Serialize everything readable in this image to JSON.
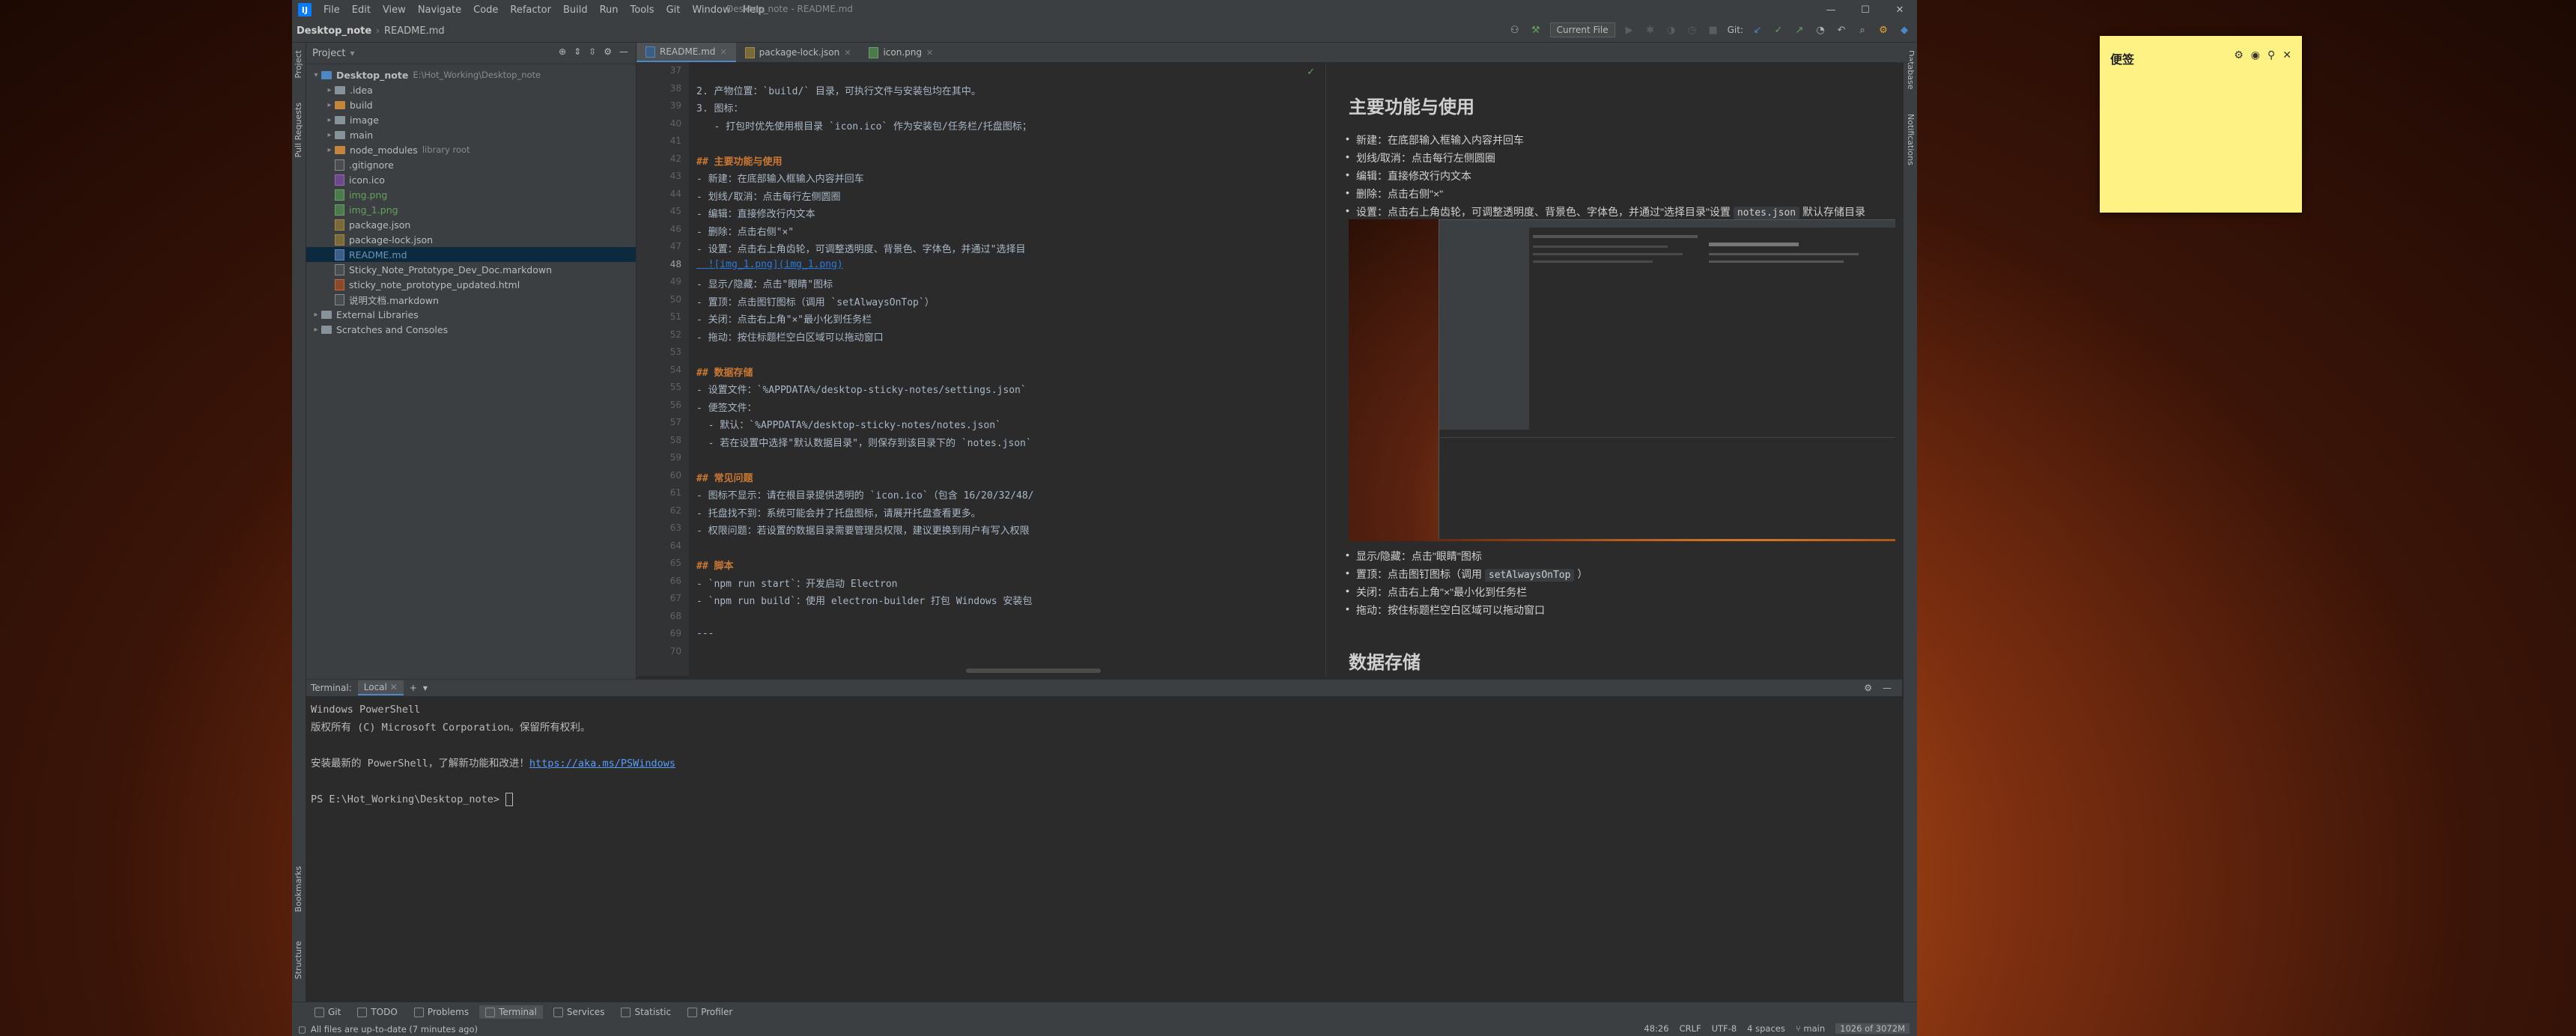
{
  "window": {
    "title": "Desktop_note - README.md"
  },
  "menu": [
    "File",
    "Edit",
    "View",
    "Navigate",
    "Code",
    "Refactor",
    "Build",
    "Run",
    "Tools",
    "Git",
    "Window",
    "Help"
  ],
  "breadcrumb": [
    "Desktop_note",
    "README.md"
  ],
  "toolbar": {
    "run_config": "Current File",
    "git_label": "Git:"
  },
  "project": {
    "header": "Project",
    "tree": [
      {
        "indent": 0,
        "arrow": "▾",
        "type": "folder",
        "label": "Desktop_note",
        "extra": "E:\\Hot_Working\\Desktop_note",
        "bold": true
      },
      {
        "indent": 1,
        "arrow": "▸",
        "type": "folder",
        "label": ".idea"
      },
      {
        "indent": 1,
        "arrow": "▸",
        "type": "folder-orange",
        "label": "build"
      },
      {
        "indent": 1,
        "arrow": "▸",
        "type": "folder",
        "label": "image"
      },
      {
        "indent": 1,
        "arrow": "▸",
        "type": "folder",
        "label": "main"
      },
      {
        "indent": 1,
        "arrow": "▸",
        "type": "folder-orange",
        "label": "node_modules",
        "extra": "library root"
      },
      {
        "indent": 1,
        "arrow": "",
        "type": "file",
        "label": ".gitignore"
      },
      {
        "indent": 1,
        "arrow": "",
        "type": "ico",
        "label": "icon.ico"
      },
      {
        "indent": 1,
        "arrow": "",
        "type": "img",
        "label": "img.png",
        "color": "green"
      },
      {
        "indent": 1,
        "arrow": "",
        "type": "img",
        "label": "img_1.png",
        "color": "green"
      },
      {
        "indent": 1,
        "arrow": "",
        "type": "json",
        "label": "package.json"
      },
      {
        "indent": 1,
        "arrow": "",
        "type": "json",
        "label": "package-lock.json"
      },
      {
        "indent": 1,
        "arrow": "",
        "type": "md",
        "label": "README.md",
        "color": "blue"
      },
      {
        "indent": 1,
        "arrow": "",
        "type": "file",
        "label": "Sticky_Note_Prototype_Dev_Doc.markdown"
      },
      {
        "indent": 1,
        "arrow": "",
        "type": "html",
        "label": "sticky_note_prototype_updated.html"
      },
      {
        "indent": 1,
        "arrow": "",
        "type": "file",
        "label": "说明文档.markdown"
      },
      {
        "indent": 0,
        "arrow": "▸",
        "type": "folder",
        "label": "External Libraries"
      },
      {
        "indent": 0,
        "arrow": "▸",
        "type": "folder",
        "label": "Scratches and Consoles"
      }
    ]
  },
  "editor_tabs": [
    {
      "label": "README.md",
      "active": true
    },
    {
      "label": "package-lock.json",
      "active": false
    },
    {
      "label": "icon.png",
      "active": false
    }
  ],
  "source": {
    "lines": [
      {
        "n": "37",
        "text": ""
      },
      {
        "n": "38",
        "text": "2. 产物位置：`build/` 目录，可执行文件与安装包均在其中。"
      },
      {
        "n": "39",
        "text": "3. 图标："
      },
      {
        "n": "40",
        "text": "   - 打包时优先使用根目录 `icon.ico` 作为安装包/任务栏/托盘图标；"
      },
      {
        "n": "41",
        "text": ""
      },
      {
        "n": "42",
        "text": "## 主要功能与使用"
      },
      {
        "n": "43",
        "text": "- 新建：在底部输入框输入内容并回车"
      },
      {
        "n": "44",
        "text": "- 划线/取消：点击每行左侧圆圈"
      },
      {
        "n": "45",
        "text": "- 编辑：直接修改行内文本"
      },
      {
        "n": "46",
        "text": "- 删除：点击右侧\"×\""
      },
      {
        "n": "47",
        "text": "- 设置：点击右上角齿轮，可调整透明度、背景色、字体色，并通过\"选择目"
      },
      {
        "n": "48",
        "text": "  ![img_1.png](img_1.png)"
      },
      {
        "n": "49",
        "text": "- 显示/隐藏：点击\"眼睛\"图标"
      },
      {
        "n": "50",
        "text": "- 置顶：点击图钉图标（调用 `setAlwaysOnTop`）"
      },
      {
        "n": "51",
        "text": "- 关闭：点击右上角\"×\"最小化到任务栏"
      },
      {
        "n": "52",
        "text": "- 拖动：按住标题栏空白区域可以拖动窗口"
      },
      {
        "n": "53",
        "text": ""
      },
      {
        "n": "54",
        "text": "## 数据存储"
      },
      {
        "n": "55",
        "text": "- 设置文件：`%APPDATA%/desktop-sticky-notes/settings.json`"
      },
      {
        "n": "56",
        "text": "- 便签文件："
      },
      {
        "n": "57",
        "text": "  - 默认：`%APPDATA%/desktop-sticky-notes/notes.json`"
      },
      {
        "n": "58",
        "text": "  - 若在设置中选择\"默认数据目录\"，则保存到该目录下的 `notes.json`"
      },
      {
        "n": "59",
        "text": ""
      },
      {
        "n": "60",
        "text": "## 常见问题"
      },
      {
        "n": "61",
        "text": "- 图标不显示：请在根目录提供透明的 `icon.ico`（包含 16/20/32/48/"
      },
      {
        "n": "62",
        "text": "- 托盘找不到：系统可能会并了托盘图标，请展开托盘查看更多。"
      },
      {
        "n": "63",
        "text": "- 权限问题：若设置的数据目录需要管理员权限，建议更换到用户有写入权限"
      },
      {
        "n": "64",
        "text": ""
      },
      {
        "n": "65",
        "text": "## 脚本"
      },
      {
        "n": "66",
        "text": "- `npm run start`：开发启动 Electron"
      },
      {
        "n": "67",
        "text": "- `npm run build`：使用 electron-builder 打包 Windows 安装包"
      },
      {
        "n": "68",
        "text": ""
      },
      {
        "n": "69",
        "text": "---"
      },
      {
        "n": "70",
        "text": ""
      }
    ]
  },
  "preview": {
    "heading1": "主要功能与使用",
    "items1": [
      "新建：在底部输入框输入内容并回车",
      "划线/取消：点击每行左侧圆圈",
      "编辑：直接修改行内文本",
      "删除：点击右侧\"×\"",
      "设置：点击右上角齿轮，可调整透明度、背景色、字体色，并通过\"选择目录\"设置"
    ],
    "settings_code": "notes.json",
    "settings_tail": "默认存储目录",
    "items2": [
      "显示/隐藏：点击\"眼睛\"图标",
      "置顶：点击图钉图标（调用",
      "关闭：点击右上角\"×\"最小化到任务栏",
      "拖动：按住标题栏空白区域可以拖动窗口"
    ],
    "pin_code": "setAlwaysOnTop",
    "pin_tail": "）",
    "heading2": "数据存储"
  },
  "terminal": {
    "title": "Terminal:",
    "tab": "Local",
    "lines": [
      "Windows PowerShell",
      "版权所有 (C) Microsoft Corporation。保留所有权利。",
      "",
      "安装最新的 PowerShell，了解新功能和改进！"
    ],
    "link": "https://aka.ms/PSWindows",
    "prompt": "PS E:\\Hot_Working\\Desktop_note> "
  },
  "bottom_tabs": [
    "Git",
    "TODO",
    "Problems",
    "Terminal",
    "Services",
    "Statistic",
    "Profiler"
  ],
  "status": {
    "message": "All files are up-to-date (7 minutes ago)",
    "position": "48:26",
    "line_sep": "CRLF",
    "encoding": "UTF-8",
    "indent": "4 spaces",
    "branch": "main",
    "memory": "1026 of 3072M"
  },
  "side_tabs": {
    "left": [
      "Project",
      "Pull Requests",
      "Bookmarks",
      "Structure"
    ],
    "right": [
      "Database",
      "Notifications"
    ]
  },
  "sticky": {
    "title": "便签"
  }
}
